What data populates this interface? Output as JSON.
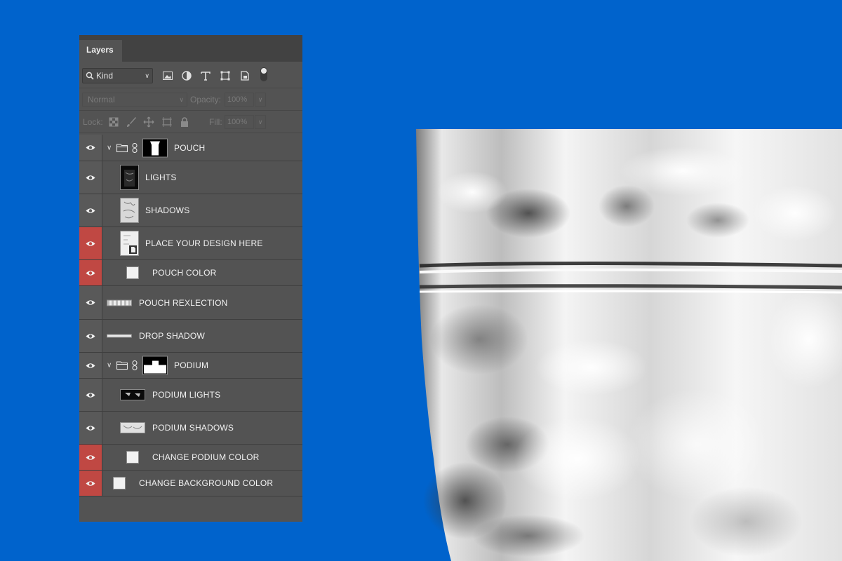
{
  "panel": {
    "tab_label": "Layers",
    "filter": {
      "kind_label": "Kind",
      "icons": [
        "search-icon",
        "image-filter-icon",
        "adjustment-filter-icon",
        "type-filter-icon",
        "shape-filter-icon",
        "smart-object-filter-icon"
      ]
    },
    "blend_mode": "Normal",
    "opacity_label": "Opacity:",
    "opacity_value": "100%",
    "lock_label": "Lock:",
    "fill_label": "Fill:",
    "fill_value": "100%"
  },
  "layers": [
    {
      "name": "POUCH",
      "type": "group",
      "eye": "gray"
    },
    {
      "name": "LIGHTS",
      "type": "layer",
      "eye": "gray"
    },
    {
      "name": "SHADOWS",
      "type": "layer",
      "eye": "gray"
    },
    {
      "name": "PLACE YOUR DESIGN HERE",
      "type": "smart",
      "eye": "red"
    },
    {
      "name": "POUCH COLOR",
      "type": "color",
      "eye": "red"
    },
    {
      "name": "POUCH REXLECTION",
      "type": "layer",
      "eye": "gray"
    },
    {
      "name": "DROP SHADOW",
      "type": "layer",
      "eye": "gray"
    },
    {
      "name": "PODIUM",
      "type": "group",
      "eye": "gray"
    },
    {
      "name": "PODIUM LIGHTS",
      "type": "layer",
      "eye": "gray"
    },
    {
      "name": "PODIUM SHADOWS",
      "type": "layer",
      "eye": "gray"
    },
    {
      "name": "CHANGE PODIUM COLOR",
      "type": "color",
      "eye": "red"
    },
    {
      "name": "CHANGE BACKGROUND COLOR",
      "type": "color",
      "eye": "red"
    }
  ],
  "colors": {
    "background": "#0063cc",
    "panel": "#535353",
    "eye_highlight": "#c04843"
  }
}
